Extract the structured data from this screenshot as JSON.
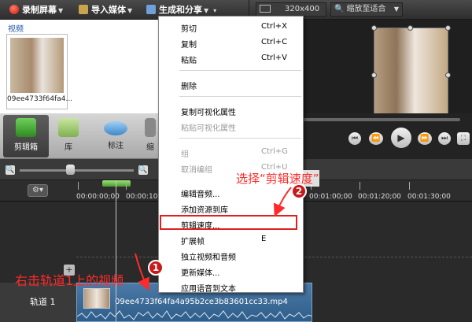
{
  "toolbar": {
    "record_label": "录制屏幕",
    "import_label": "导入媒体",
    "share_label": "生成和分享",
    "size_value": "320x400",
    "zoom_value": "缩放至适合"
  },
  "clipbin": {
    "title": "视频",
    "clip_name": "09ee4733f64fa4..."
  },
  "tabs": [
    {
      "label": "剪辑箱"
    },
    {
      "label": "库"
    },
    {
      "label": "标注"
    },
    {
      "label": "缩"
    }
  ],
  "timeline": {
    "ticks": [
      "00:00:00;00",
      "00:00:10;00",
      "00:01:00;00",
      "00:01:20;00",
      "00:01:30;00"
    ],
    "track_label": "轨道 1",
    "clip_title": "09ee4733f64fa4a95b2ce3b83601cc33.mp4"
  },
  "context_menu": {
    "items": [
      {
        "label": "剪切",
        "shortcut": "Ctrl+X",
        "enabled": true
      },
      {
        "label": "复制",
        "shortcut": "Ctrl+C",
        "enabled": true
      },
      {
        "label": "粘贴",
        "shortcut": "Ctrl+V",
        "enabled": true
      },
      {
        "label": "删除",
        "shortcut": "",
        "enabled": true
      },
      {
        "label": "复制可视化属性",
        "shortcut": "",
        "enabled": true
      },
      {
        "label": "粘贴可视化属性",
        "shortcut": "",
        "enabled": false
      },
      {
        "label": "组",
        "shortcut": "Ctrl+G",
        "enabled": false
      },
      {
        "label": "取消编组",
        "shortcut": "Ctrl+U",
        "enabled": false
      },
      {
        "label": "编辑音频...",
        "shortcut": "",
        "enabled": true
      },
      {
        "label": "添加资源到库",
        "shortcut": "",
        "enabled": true
      },
      {
        "label": "剪辑速度...",
        "shortcut": "",
        "enabled": true
      },
      {
        "label": "扩展帧",
        "shortcut": "E",
        "enabled": true
      },
      {
        "label": "独立视频和音频",
        "shortcut": "",
        "enabled": true
      },
      {
        "label": "更新媒体...",
        "shortcut": "",
        "enabled": true
      },
      {
        "label": "应用语音到文本",
        "shortcut": "",
        "enabled": true
      }
    ]
  },
  "annotations": {
    "step1_text": "右击轨道1上的视频",
    "step2_text": "选择“剪辑速度”",
    "step1_badge": "1",
    "step2_badge": "2"
  },
  "colors": {
    "annotation_red": "#ff2a2a",
    "clip_blue": "#2f5d8a",
    "playhead_green": "#4a9d2f"
  }
}
